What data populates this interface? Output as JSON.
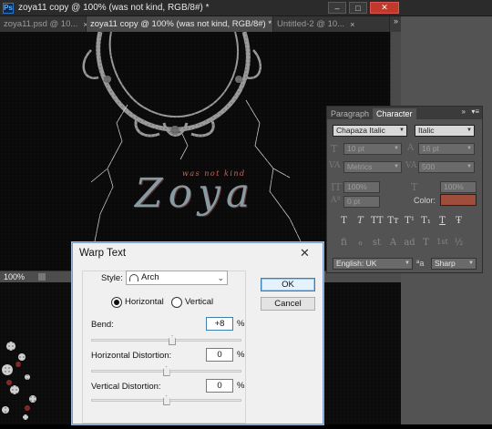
{
  "window": {
    "app_icon": "Ps",
    "title": "zoya11 copy @ 100% (was not kind, RGB/8#) *",
    "min_label": "–",
    "max_label": "□",
    "close_label": "✕"
  },
  "tabs": [
    {
      "label": "zoya11.psd @ 10...",
      "close": "×"
    },
    {
      "label": "zoya11 copy @ 100% (was not kind, RGB/8#) *",
      "close": "×"
    },
    {
      "label": "Untitled-2 @ 10...",
      "close": "×"
    }
  ],
  "tabs_overflow": "»",
  "artwork": {
    "small_caption": "was not kind",
    "script_title": "Zoya"
  },
  "status": {
    "zoom": "100%"
  },
  "character_panel": {
    "tab_paragraph": "Paragraph",
    "tab_character": "Character",
    "collapse_icon": "»",
    "menu_icon": "▾≡",
    "font_family": "Chapaza Italic",
    "font_style": "Italic",
    "font_size": "10 pt",
    "leading": "16 pt",
    "kerning": "Metrics",
    "tracking": "500",
    "vertical_scale": "100%",
    "horizontal_scale": "100%",
    "baseline_shift": "0 pt",
    "color_label": "Color:",
    "color_value": "#a04e3c",
    "style_buttons": [
      "T",
      "T",
      "TT",
      "Tт",
      "T¹",
      "T₁",
      "T",
      "Ŧ"
    ],
    "opentype_buttons": [
      "fi",
      "ℴ",
      "st",
      "A",
      "ad",
      "T",
      "1st",
      "½"
    ],
    "language": "English: UK",
    "aa_label": "ªa",
    "antialias": "Sharp"
  },
  "warp_dialog": {
    "title": "Warp Text",
    "close": "✕",
    "style_label": "Style:",
    "style_value": "Arch",
    "orientation_horizontal": "Horizontal",
    "orientation_vertical": "Vertical",
    "orientation_selected": "Horizontal",
    "bend_label": "Bend:",
    "bend_value": "+8",
    "bend_percent": 8,
    "h_distortion_label": "Horizontal Distortion:",
    "h_distortion_value": "0",
    "h_distortion_percent": 0,
    "v_distortion_label": "Vertical Distortion:",
    "v_distortion_value": "0",
    "v_distortion_percent": 0,
    "percent_sign": "%",
    "ok_label": "OK",
    "cancel_label": "Cancel"
  }
}
